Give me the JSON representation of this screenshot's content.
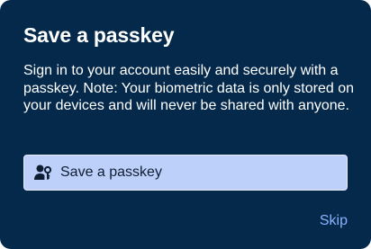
{
  "dialog": {
    "title": "Save a passkey",
    "description": "Sign in to your account easily and securely with a passkey. Note: Your biometric data is only stored on your devices and will never be shared with anyone.",
    "primary_button": {
      "label": "Save a passkey",
      "icon": "user-key-icon"
    },
    "skip_label": "Skip"
  },
  "colors": {
    "dialog_background": "#04294a",
    "button_background": "#bcd0fa",
    "button_text": "#0f1d33",
    "link": "#8ab2ff",
    "text": "#ffffff"
  }
}
